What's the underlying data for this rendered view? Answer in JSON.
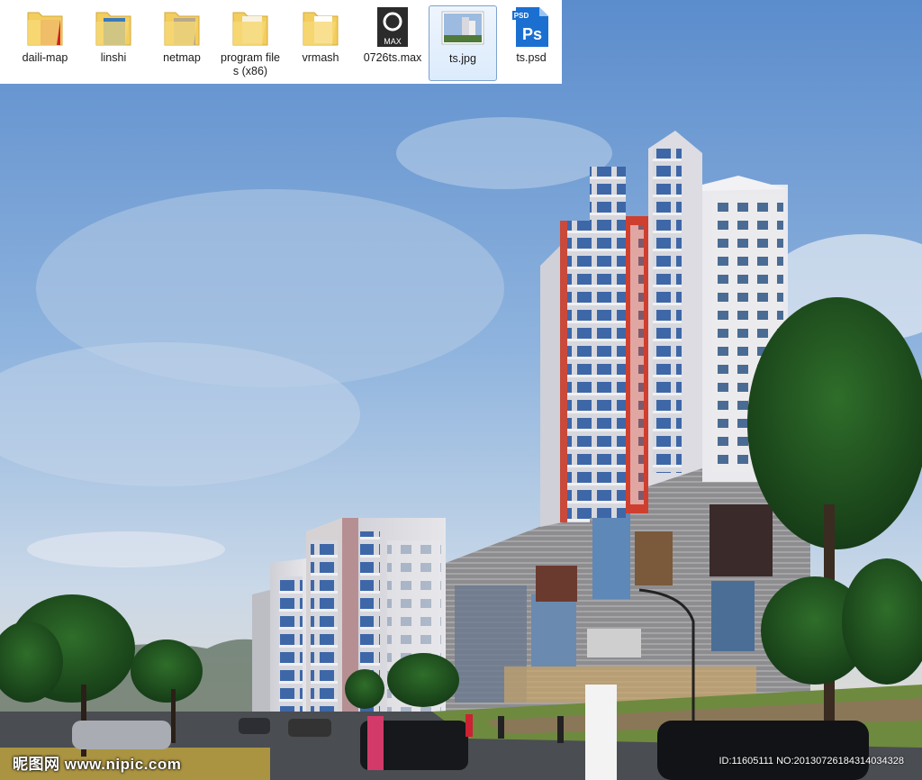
{
  "files": [
    {
      "name": "daili-map",
      "icon": "folder-icon"
    },
    {
      "name": "linshi",
      "icon": "folder-icon"
    },
    {
      "name": "netmap",
      "icon": "folder-icon"
    },
    {
      "name": "program files (x86)",
      "icon": "folder-icon"
    },
    {
      "name": "vrmash",
      "icon": "folder-icon"
    },
    {
      "name": "0726ts.max",
      "icon": "3dsmax-file-icon"
    },
    {
      "name": "ts.jpg",
      "icon": "image-file-icon",
      "selected": true
    },
    {
      "name": "ts.psd",
      "icon": "photoshop-file-icon"
    }
  ],
  "max_icon_text": "MAX",
  "psd_icon_text": "PSD",
  "ps_icon_text": "Ps",
  "watermark": {
    "site": "昵图网 www.nipic.com",
    "id": "ID:11605111 NO:20130726184314034328"
  },
  "colors": {
    "folder": "#f3cd5e",
    "ps_blue": "#1b6fd1",
    "max_dark": "#2b2b2b",
    "selection_border": "#7da2ce"
  }
}
